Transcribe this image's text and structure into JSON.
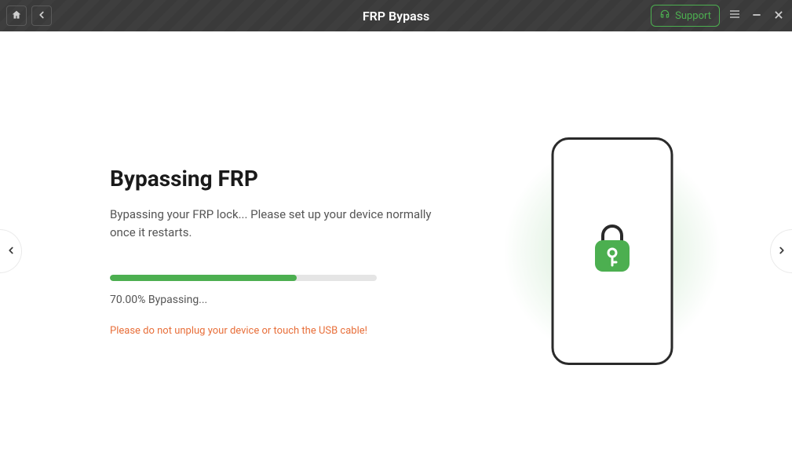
{
  "titlebar": {
    "title": "FRP Bypass",
    "support_label": "Support"
  },
  "main": {
    "heading": "Bypassing FRP",
    "description": "Bypassing your FRP lock... Please set up your device normally once it restarts.",
    "progress": {
      "percent": 70.0,
      "percent_label": "70.00%",
      "status_label": "Bypassing..."
    },
    "warning": "Please do not unplug your device or touch the USB cable!"
  },
  "colors": {
    "accent": "#4CAF50",
    "warning": "#e86f3a"
  },
  "icons": {
    "home": "home-icon",
    "back": "chevron-left-icon",
    "support": "headset-icon",
    "menu": "menu-icon",
    "minimize": "minimize-icon",
    "close": "close-icon",
    "lock": "lock-key-icon",
    "carousel_prev": "chevron-left-icon",
    "carousel_next": "chevron-right-icon"
  }
}
